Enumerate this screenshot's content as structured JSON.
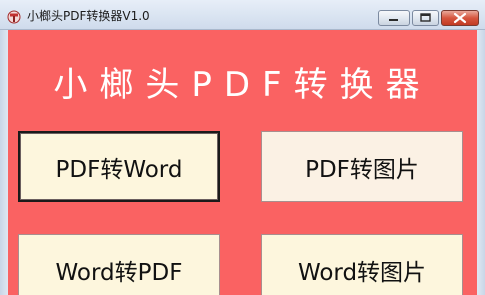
{
  "window": {
    "title": "小榔头PDF转换器V1.0",
    "icon": "hammer-logo-icon",
    "controls": {
      "minimize_icon": "minimize-icon",
      "maximize_icon": "maximize-icon",
      "close_icon": "close-icon"
    }
  },
  "main": {
    "heading": "小榔头PDF转换器",
    "buttons": [
      {
        "label": "PDF转Word"
      },
      {
        "label": "PDF转图片"
      },
      {
        "label": "Word转PDF"
      },
      {
        "label": "Word转图片"
      }
    ]
  },
  "colors": {
    "background": "#fa6262",
    "button_face": "#fdf6dd",
    "heading_text": "#ffffff"
  }
}
